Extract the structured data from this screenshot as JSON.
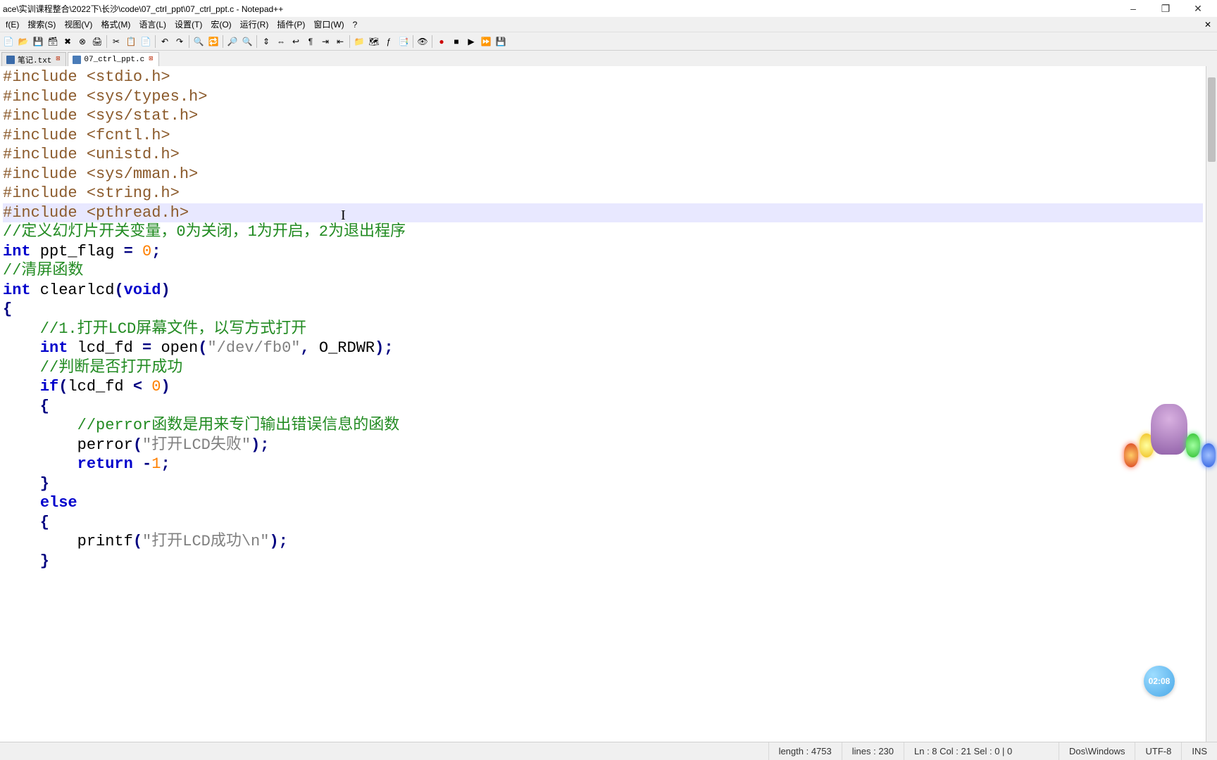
{
  "window": {
    "title": "ace\\实训课程整合\\2022下\\长沙\\code\\07_ctrl_ppt\\07_ctrl_ppt.c - Notepad++",
    "minimize": "–",
    "maximize": "❐",
    "close": "✕"
  },
  "menu": {
    "file": "f(E)",
    "search": "搜索(S)",
    "view": "视图(V)",
    "format": "格式(M)",
    "lang": "语言(L)",
    "settings": "设置(T)",
    "macro": "宏(O)",
    "run": "运行(R)",
    "plugin": "插件(P)",
    "window": "窗口(W)",
    "help": "?"
  },
  "tabs": [
    {
      "label": "笔记.txt",
      "active": false
    },
    {
      "label": "07_ctrl_ppt.c",
      "active": true
    }
  ],
  "status": {
    "length": "length : 4753",
    "lines": "lines : 230",
    "pos": "Ln : 8    Col : 21    Sel : 0 | 0",
    "eol": "Dos\\Windows",
    "enc": "UTF-8",
    "mode": "INS"
  },
  "timer": "02:08",
  "code": {
    "l1": "#include <stdio.h>",
    "l2": "#include <sys/types.h>",
    "l3": "#include <sys/stat.h>",
    "l4": "#include <fcntl.h>",
    "l5": "#include <unistd.h>",
    "l6": "#include <sys/mman.h>",
    "l7": "#include <string.h>",
    "l8": "#include <pthread.h>",
    "l9": "",
    "l10": "//定义幻灯片开关变量，0为关闭，1为开启，2为退出程序",
    "l11a": "int",
    "l11b": " ppt_flag ",
    "l11c": "=",
    "l11d": " ",
    "l11e": "0",
    "l11f": ";",
    "l12": "",
    "l13": "//清屏函数",
    "l14a": "int",
    "l14b": " clearlcd",
    "l14c": "(",
    "l14d": "void",
    "l14e": ")",
    "l15": "{",
    "l16": "    //1.打开LCD屏幕文件，以写方式打开",
    "l17a": "    ",
    "l17b": "int",
    "l17c": " lcd_fd ",
    "l17d": "=",
    "l17e": " open",
    "l17f": "(",
    "l17g": "\"/dev/fb0\"",
    "l17h": ",",
    "l17i": " O_RDWR",
    "l17j": ");",
    "l18": "    //判断是否打开成功",
    "l19a": "    ",
    "l19b": "if",
    "l19c": "(",
    "l19d": "lcd_fd ",
    "l19e": "<",
    "l19f": " ",
    "l19g": "0",
    "l19h": ")",
    "l20": "    {",
    "l21": "        //perror函数是用来专门输出错误信息的函数",
    "l22a": "        perror",
    "l22b": "(",
    "l22c": "\"打开LCD失败\"",
    "l22d": ");",
    "l23a": "        ",
    "l23b": "return",
    "l23c": " ",
    "l23d": "-",
    "l23e": "1",
    "l23f": ";",
    "l24": "    }",
    "l25a": "    ",
    "l25b": "else",
    "l26": "    {",
    "l27a": "        printf",
    "l27b": "(",
    "l27c": "\"打开LCD成功\\n\"",
    "l27d": ");",
    "l28": "    }"
  }
}
